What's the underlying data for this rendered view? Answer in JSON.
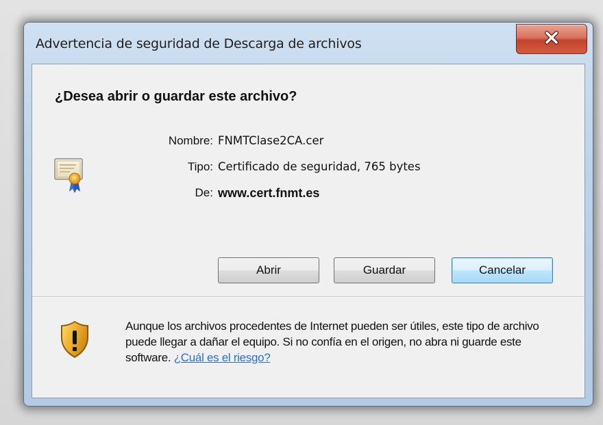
{
  "window": {
    "title": "Advertencia de seguridad de Descarga de archivos",
    "close_label": "x"
  },
  "dialog": {
    "question": "¿Desea abrir o guardar este archivo?",
    "file": {
      "name_label": "Nombre:",
      "name_value": "FNMTClase2CA.cer",
      "type_label": "Tipo:",
      "type_value": "Certificado de seguridad, 765 bytes",
      "from_label": "De:",
      "from_value": "www.cert.fnmt.es"
    },
    "buttons": {
      "open": "Abrir",
      "save": "Guardar",
      "cancel": "Cancelar"
    },
    "warning": {
      "text": "Aunque los archivos procedentes de Internet pueden ser útiles, este tipo de archivo puede llegar a dañar el equipo. Si no confía en el origen, no abra ni guarde este software.",
      "link": "¿Cuál es el riesgo?"
    }
  },
  "icons": {
    "file_icon": "certificate-icon",
    "warning_icon": "shield-warning-icon",
    "close_icon": "close-icon"
  },
  "colors": {
    "link": "#2a6fcf",
    "close_button": "#c2432b",
    "default_button_border": "#3c7fb1"
  }
}
